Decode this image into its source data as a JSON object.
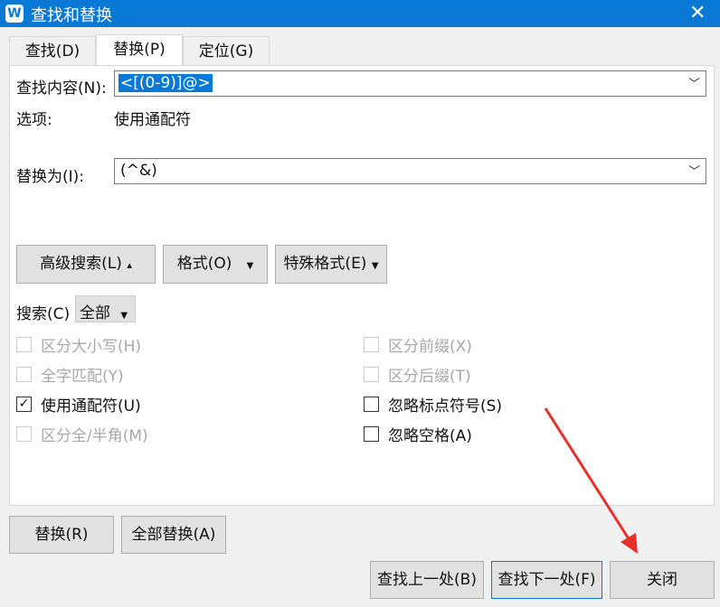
{
  "window": {
    "title": "查找和替换",
    "logo": "W",
    "close_icon": "close-icon"
  },
  "tabs": [
    {
      "label": "查找(D)"
    },
    {
      "label": "替换(P)",
      "active": true
    },
    {
      "label": "定位(G)"
    }
  ],
  "find": {
    "label": "查找内容(N):",
    "value": "<[(0-9)]@>"
  },
  "options": {
    "label": "选项:",
    "value": "使用通配符"
  },
  "replace": {
    "label": "替换为(I):",
    "value": "(^&)"
  },
  "buttons": {
    "advanced": "高级搜索(L)",
    "format": "格式(O)",
    "special": "特殊格式(E)",
    "replace": "替换(R)",
    "replace_all": "全部替换(A)",
    "find_prev": "查找上一处(B)",
    "find_next": "查找下一处(F)",
    "close": "关闭"
  },
  "search": {
    "label": "搜索(C)",
    "value": "全部"
  },
  "checkboxes_left": [
    {
      "label": "区分大小写(H)",
      "checked": false,
      "disabled": true
    },
    {
      "label": "全字匹配(Y)",
      "checked": false,
      "disabled": true
    },
    {
      "label": "使用通配符(U)",
      "checked": true,
      "disabled": false
    },
    {
      "label": "区分全/半角(M)",
      "checked": false,
      "disabled": true
    }
  ],
  "checkboxes_right": [
    {
      "label": "区分前缀(X)",
      "checked": false,
      "disabled": true
    },
    {
      "label": "区分后缀(T)",
      "checked": false,
      "disabled": true
    },
    {
      "label": "忽略标点符号(S)",
      "checked": false,
      "disabled": false
    },
    {
      "label": "忽略空格(A)",
      "checked": false,
      "disabled": false
    }
  ],
  "colors": {
    "accent": "#0a79d6",
    "annotation_arrow": "#e8302a"
  }
}
